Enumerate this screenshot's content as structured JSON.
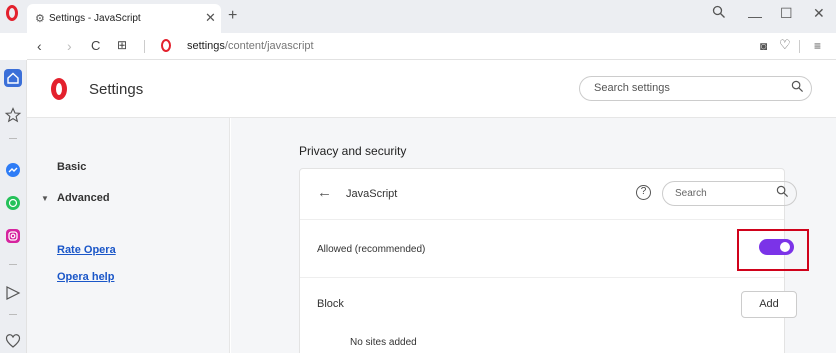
{
  "tab": {
    "title": "Settings - JavaScript",
    "close": "✕",
    "new_tab": "+"
  },
  "window_controls": {
    "search": "⚲",
    "minimize": "—",
    "maximize": "☐",
    "close": "✕"
  },
  "address_bar": {
    "back": "‹",
    "forward": "›",
    "reload": "C",
    "speed_dial": "⊞",
    "url_host": "settings",
    "url_path": "/content/javascript",
    "snapshot": "◙",
    "heart": "♡",
    "menu": "≡"
  },
  "settings": {
    "title": "Settings",
    "search_placeholder": "Search settings"
  },
  "nav": {
    "basic": "Basic",
    "advanced_caret": "▼",
    "advanced": "Advanced",
    "rate_opera": "Rate Opera",
    "opera_help": "Opera help"
  },
  "main": {
    "section_title": "Privacy and security",
    "card_title": "JavaScript",
    "back": "←",
    "help": "?",
    "search_placeholder": "Search",
    "allowed_label": "Allowed (recommended)",
    "allowed_enabled": true,
    "block_label": "Block",
    "add_button": "Add",
    "no_sites": "No sites added"
  },
  "colors": {
    "opera_red": "#e3212d",
    "toggle_on": "#7b33e8",
    "highlight": "#d0021b",
    "link": "#1a56c8"
  }
}
